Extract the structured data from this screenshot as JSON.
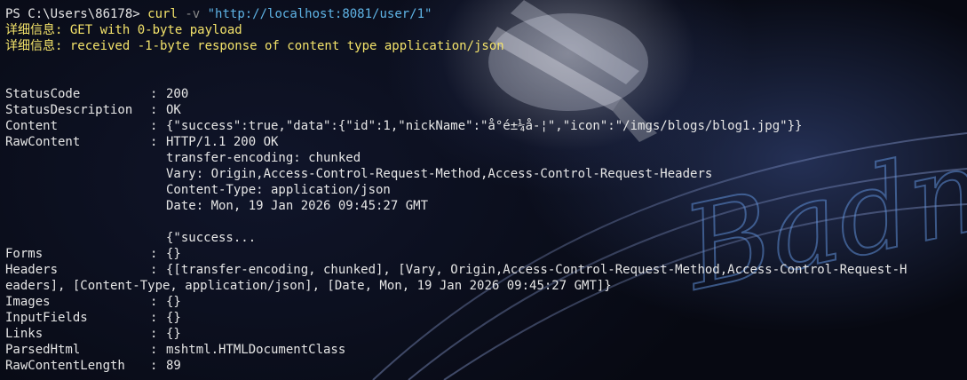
{
  "terminal": {
    "prompt": "PS C:\\Users\\86178> ",
    "command": "curl",
    "flag": "-v",
    "url": "\"http://localhost:8081/user/1\"",
    "verbose_lines": [
      "详细信息: GET with 0-byte payload",
      "详细信息: received -1-byte response of content type application/json"
    ],
    "separator": ": ",
    "fields": {
      "status_code": {
        "key": "StatusCode",
        "value": "200"
      },
      "status_description": {
        "key": "StatusDescription",
        "value": "OK"
      },
      "content": {
        "key": "Content",
        "value": "{\"success\":true,\"data\":{\"id\":1,\"nickName\":\"å°é±¼å­-¦\",\"icon\":\"/imgs/blogs/blog1.jpg\"}}"
      },
      "raw_content": {
        "key": "RawContent",
        "lines": [
          "HTTP/1.1 200 OK",
          "transfer-encoding: chunked",
          "Vary: Origin,Access-Control-Request-Method,Access-Control-Request-Headers",
          "Content-Type: application/json",
          "Date: Mon, 19 Jan 2026 09:45:27 GMT",
          "",
          "{\"success..."
        ]
      },
      "forms": {
        "key": "Forms",
        "value": "{}"
      },
      "headers": {
        "key": "Headers",
        "value_line1": "{[transfer-encoding, chunked], [Vary, Origin,Access-Control-Request-Method,Access-Control-Request-H",
        "value_line2": "eaders], [Content-Type, application/json], [Date, Mon, 19 Jan 2026 09:45:27 GMT]}"
      },
      "images": {
        "key": "Images",
        "value": "{}"
      },
      "input_fields": {
        "key": "InputFields",
        "value": "{}"
      },
      "links": {
        "key": "Links",
        "value": "{}"
      },
      "parsed_html": {
        "key": "ParsedHtml",
        "value": "mshtml.HTMLDocumentClass"
      },
      "raw_content_length": {
        "key": "RawContentLength",
        "value": "89"
      }
    }
  },
  "background": {
    "watermark_text": "Badm"
  },
  "colors": {
    "background": "#0b0f1e",
    "foreground": "#e6e6e6",
    "command": "#f4e36a",
    "string": "#5fb4e6",
    "parameter": "#8a8a8a",
    "verbose": "#f4e36a"
  }
}
